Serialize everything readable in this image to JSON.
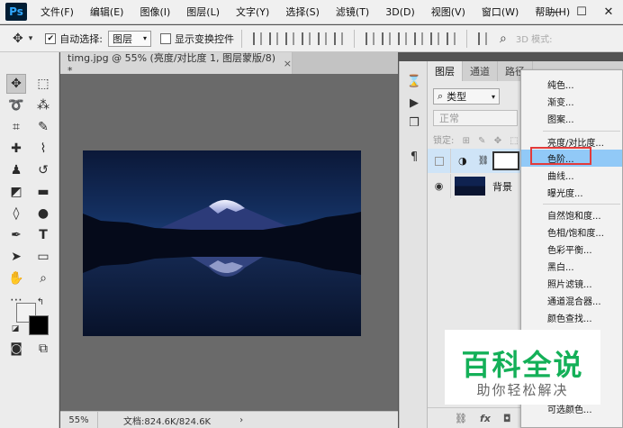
{
  "app": {
    "logo": "Ps"
  },
  "menu": [
    "文件(F)",
    "编辑(E)",
    "图像(I)",
    "图层(L)",
    "文字(Y)",
    "选择(S)",
    "滤镜(T)",
    "3D(D)",
    "视图(V)",
    "窗口(W)",
    "帮助(H)"
  ],
  "window_controls": {
    "minimize": "—",
    "maximize": "☐",
    "close": "✕"
  },
  "options": {
    "auto_select_label": "自动选择:",
    "auto_select_value": "图层",
    "show_transform_label": "显示变换控件",
    "mode_3d": "3D 模式:"
  },
  "document": {
    "tab_title": "timg.jpg @ 55% (亮度/对比度 1, 图层蒙版/8) *",
    "close": "×",
    "zoom": "55%",
    "doc_size": "文档:824.6K/824.6K",
    "arrow": "›"
  },
  "layers_panel": {
    "tabs": [
      "图层",
      "通道",
      "路径"
    ],
    "filter_label": "类型",
    "blend_mode": "正常",
    "lock_label": "锁定:",
    "layers": [
      {
        "name": "",
        "kind": "adjustment"
      },
      {
        "name": "背景",
        "kind": "image"
      }
    ],
    "footer_fx": "fx"
  },
  "adjust_menu": {
    "items": [
      "纯色...",
      "渐变...",
      "图案...",
      "亮度/对比度...",
      "色阶...",
      "曲线...",
      "曝光度...",
      "自然饱和度...",
      "色相/饱和度...",
      "色彩平衡...",
      "黑白...",
      "照片滤镜...",
      "通道混合器...",
      "颜色查找...",
      "可选颜色..."
    ],
    "highlighted": "色阶..."
  },
  "watermark": {
    "title": "百科全说",
    "subtitle": "助你轻松解决"
  },
  "colors": {
    "accent": "#31a8ff",
    "highlight": "#91c9f7",
    "annotation": "#e23b3b",
    "watermark": "#14b058"
  }
}
